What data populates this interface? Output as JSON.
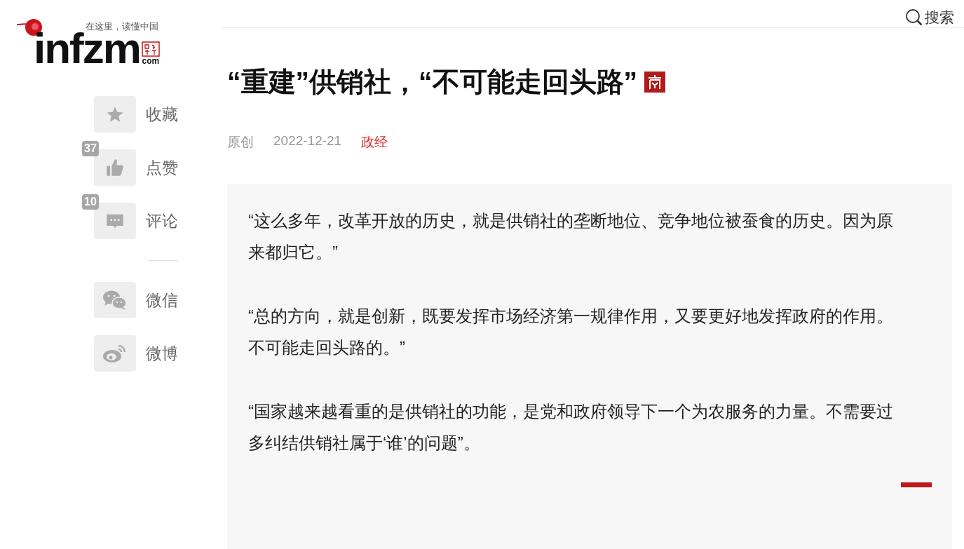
{
  "logo": {
    "wordmark": "infzm",
    "tagline": "在这里，读懂中国",
    "domain": "com"
  },
  "search": {
    "label": "搜索"
  },
  "sidebar": {
    "actions": [
      {
        "kind": "star",
        "label": "收藏"
      },
      {
        "kind": "thumb",
        "label": "点赞",
        "count": "37"
      },
      {
        "kind": "comment",
        "label": "评论",
        "count": "10"
      }
    ],
    "share": [
      {
        "kind": "wechat",
        "label": "微信"
      },
      {
        "kind": "weibo",
        "label": "微博"
      }
    ]
  },
  "article": {
    "title": "“重建”供销社，“不可能走回头路”",
    "source": "原创",
    "date": "2022-12-21",
    "category": "政经",
    "quotes": [
      "“这么多年，改革开放的历史，就是供销社的垄断地位、竞争地位被蚕食的历史。因为原来都归它。”",
      "“总的方向，就是创新，既要发挥市场经济第一规律作用，又要更好地发挥政府的作用。不可能走回头路的。”",
      "“国家越来越看重的是供销社的功能，是党和政府领导下一个为农服务的力量。不需要过多纠结供销社属于‘谁’的问题”。"
    ]
  }
}
